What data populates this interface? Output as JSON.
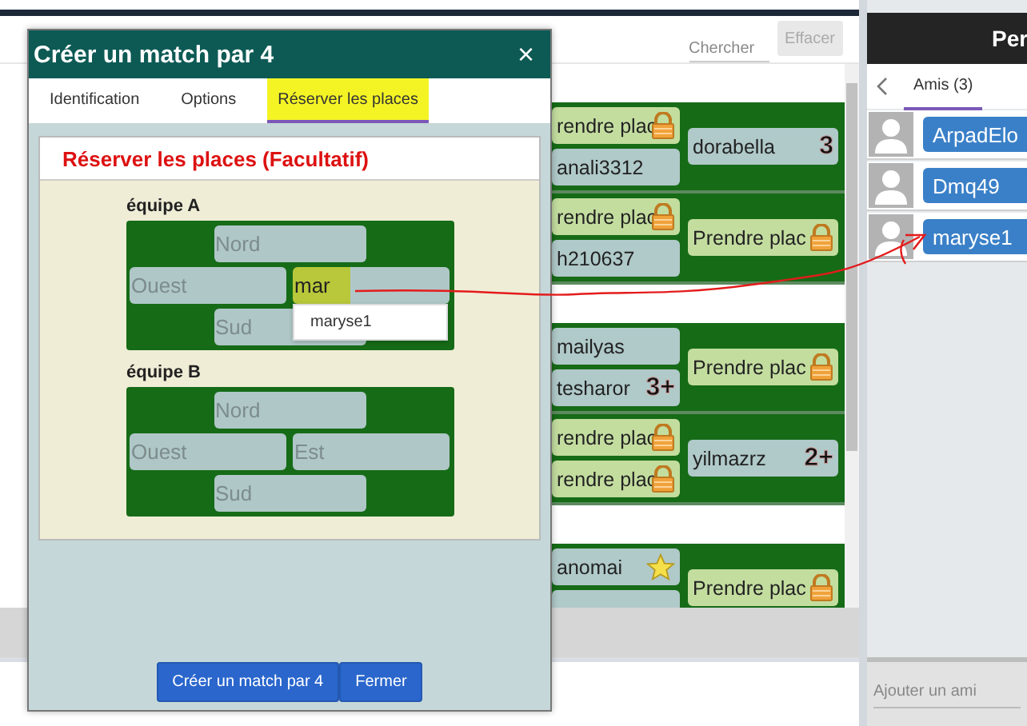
{
  "search": {
    "placeholder": "Chercher",
    "clear": "Effacer",
    "clear_disabled": true
  },
  "table_groups": [
    [
      {
        "left": [
          {
            "kind": "place",
            "text": "rendre plac"
          },
          {
            "kind": "player",
            "text": "anali3312"
          }
        ],
        "right": [
          {
            "kind": "player",
            "text": "dorabella",
            "badge": "3"
          }
        ]
      },
      {
        "left": [
          {
            "kind": "place",
            "text": "rendre plac"
          },
          {
            "kind": "player",
            "text": "h210637"
          }
        ],
        "right": [
          {
            "kind": "place",
            "text": "Prendre plac"
          }
        ]
      }
    ],
    [
      {
        "left": [
          {
            "kind": "player",
            "text": "mailyas"
          },
          {
            "kind": "player",
            "text": "tesharor",
            "badge": "3+"
          }
        ],
        "right": [
          {
            "kind": "place",
            "text": "Prendre plac"
          }
        ]
      },
      {
        "left": [
          {
            "kind": "place",
            "text": "rendre plac"
          },
          {
            "kind": "place",
            "text": "rendre plac"
          }
        ],
        "right": [
          {
            "kind": "player",
            "text": "yilmazrz",
            "badge": "2+"
          }
        ]
      }
    ],
    [
      {
        "left": [
          {
            "kind": "player",
            "text": "anomai",
            "starred": true
          },
          {
            "kind": "player"
          }
        ],
        "right": [
          {
            "kind": "place",
            "text": "Prendre plac"
          }
        ]
      }
    ]
  ],
  "side_panel": {
    "title": "Per",
    "tabs": [
      {
        "label": "Amis (3)",
        "selected": true
      }
    ],
    "friends": [
      "ArpadElo",
      "Dmq49",
      "maryse1"
    ],
    "add_friend_placeholder": "Ajouter un ami"
  },
  "modal": {
    "title": "Créer un match par 4",
    "close": "×",
    "tabs": [
      {
        "label": "Identification",
        "selected": false,
        "highlighted": false
      },
      {
        "label": "Options",
        "selected": false,
        "highlighted": false
      },
      {
        "label": "Réserver les places",
        "selected": true,
        "highlighted": true
      }
    ],
    "section_title": "Réserver les places (Facultatif)",
    "teams": [
      {
        "label": "équipe A",
        "seats": [
          {
            "kind": "north",
            "placeholder": "Nord",
            "highlighted": false
          },
          {
            "kind": "west",
            "placeholder": "Ouest",
            "highlighted": false
          },
          {
            "kind": "east",
            "value": "mar",
            "highlighted": true
          },
          {
            "kind": "south",
            "placeholder": "Sud",
            "highlighted": false
          }
        ],
        "suggestions": [
          "maryse1"
        ]
      },
      {
        "label": "équipe B",
        "seats": [
          {
            "kind": "north",
            "placeholder": "Nord",
            "highlighted": false
          },
          {
            "kind": "west",
            "placeholder": "Ouest",
            "highlighted": false
          },
          {
            "kind": "east",
            "placeholder": "Est",
            "highlighted": false
          },
          {
            "kind": "south",
            "placeholder": "Sud",
            "highlighted": false
          }
        ]
      }
    ],
    "buttons": [
      "Créer un match par 4",
      "Fermer"
    ]
  }
}
